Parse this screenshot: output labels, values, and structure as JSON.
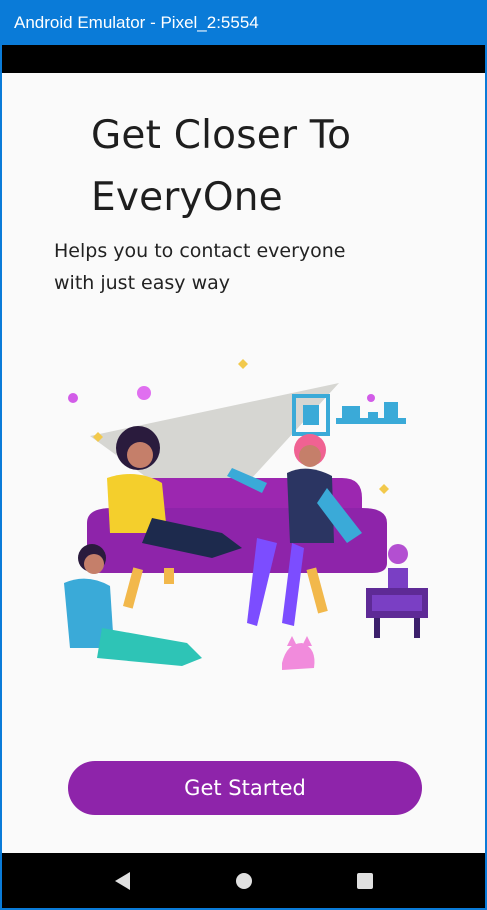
{
  "window": {
    "title": "Android Emulator - Pixel_2:5554"
  },
  "onboarding": {
    "headline_line1": "Get Closer To",
    "headline_line2": "EveryOne",
    "subtitle_line1": "Helps you to contact everyone",
    "subtitle_line2": "with just easy way",
    "cta_label": "Get Started",
    "illustration": "friends-on-couch-illustration"
  },
  "navbar": {
    "back": "back-icon",
    "home": "home-icon",
    "recents": "recents-icon"
  },
  "colors": {
    "titlebar": "#0a7bd8",
    "accent": "#8e24aa",
    "sofa": "#8e24aa",
    "screen_bg": "#fafafa"
  }
}
